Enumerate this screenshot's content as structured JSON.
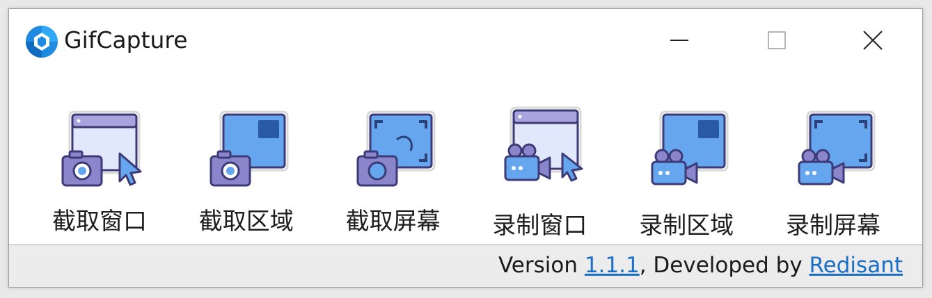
{
  "window": {
    "title": "GifCapture",
    "logo_icon": "gifcapture-logo-icon",
    "controls": [
      "minimize-icon",
      "maximize-icon",
      "close-icon"
    ]
  },
  "tools": [
    {
      "label": "截取窗口",
      "icon": "capture-window-icon",
      "mode": "screenshot"
    },
    {
      "label": "截取区域",
      "icon": "capture-region-icon",
      "mode": "screenshot"
    },
    {
      "label": "截取屏幕",
      "icon": "capture-screen-icon",
      "mode": "screenshot"
    },
    {
      "label": "录制窗口",
      "icon": "record-window-icon",
      "mode": "record"
    },
    {
      "label": "录制区域",
      "icon": "record-region-icon",
      "mode": "record"
    },
    {
      "label": "录制屏幕",
      "icon": "record-screen-icon",
      "mode": "record"
    }
  ],
  "status": {
    "version_prefix": "Version ",
    "version": "1.1.1",
    "developed_by": ", Developed by ",
    "developer": "Redisant"
  },
  "colors": {
    "logo_blue": "#1e8be0",
    "screen_blue": "#66a6ef",
    "screen_dark": "#2b5aa5",
    "icon_outline": "#3c3a77",
    "camera_purple": "#8b86cc",
    "window_title_bar": "#a9a3de",
    "link": "#1a6fc6"
  }
}
